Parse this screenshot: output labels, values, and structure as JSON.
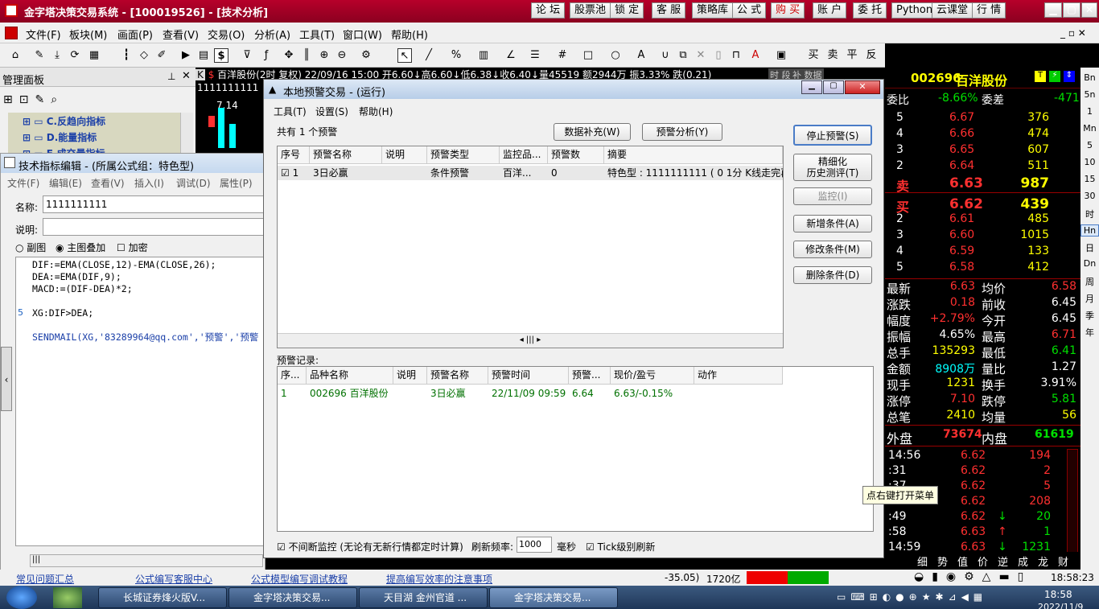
{
  "app": {
    "title": "金字塔决策交易系统 - [100019526] - [技术分析]"
  },
  "top_buttons": [
    "论 坛",
    "股票池",
    "锁 定",
    "客 服",
    "策略库",
    "公 式",
    "购 买",
    "账 户",
    "委 托",
    "Python",
    "云课堂",
    "行 情"
  ],
  "menu": [
    "文件(F)",
    "板块(M)",
    "画面(P)",
    "查看(V)",
    "交易(O)",
    "分析(A)",
    "工具(T)",
    "窗口(W)",
    "帮助(H)"
  ],
  "toolbar_right": [
    "买",
    "卖",
    "平",
    "反"
  ],
  "left_panel": {
    "title": "管理面板",
    "items": [
      "C.反趋向指标",
      "D.能量指标",
      "E.成交量指标"
    ]
  },
  "editor": {
    "title": "技术指标编辑 - (所属公式组：特色型)",
    "menu": [
      "文件(F)",
      "编辑(E)",
      "查看(V)",
      "插入(I)",
      "调试(D)",
      "属性(P)"
    ],
    "name_label": "名称:",
    "name_value": "1111111111",
    "desc_label": "说明:",
    "opt1": "副图",
    "opt2": "主图叠加",
    "opt3": "加密",
    "code": [
      "DIF:=EMA(CLOSE,12)-EMA(CLOSE,26);",
      "DEA:=EMA(DIF,9);",
      "MACD:=(DIF-DEA)*2;",
      "",
      "XG:DIF>DEA;",
      "",
      "SENDMAIL(XG,'83289964@qq.com','预警','预警"
    ],
    "line5": "5"
  },
  "chart": {
    "header": "百洋股份(2时 复权) 22/09/16 15:00 开6.60↓高6.60↓低6.38↓收6.40↓量45519 额2944万 振3.33% 跌(0.21)",
    "label1": "1111111111",
    "label2": "7.14",
    "tag1": "时 段",
    "tag2": "补 数据"
  },
  "dialog": {
    "title": "本地预警交易 - (运行)",
    "menu": [
      "工具(T)",
      "设置(S)",
      "帮助(H)"
    ],
    "count": "共有 1 个预警",
    "btn_data": "数据补充(W)",
    "btn_analysis": "预警分析(Y)",
    "headers": [
      "序号",
      "预警名称",
      "说明",
      "预警类型",
      "监控品...",
      "预警数",
      "摘要"
    ],
    "row": {
      "seq": "1",
      "name": "3日必赢",
      "desc": "",
      "type": "条件预警",
      "target": "百洋...",
      "num": "0",
      "summary": "特色型 : 1111111111 ( 0 1分 K线走完再"
    },
    "btn_stop": "停止预警(S)",
    "btn_refine_1": "精细化",
    "btn_refine_2": "历史测评(T)",
    "btn_monitor": "监控(I)",
    "btn_add": "新增条件(A)",
    "btn_edit": "修改条件(M)",
    "btn_del": "删除条件(D)",
    "records_label": "预警记录:",
    "rec_headers": [
      "序...",
      "品种名称",
      "说明",
      "预警名称",
      "预警时间",
      "预警...",
      "现价/盈亏",
      "动作"
    ],
    "rec_row": {
      "seq": "1",
      "symbol": "002696 百洋股份",
      "desc": "",
      "name": "3日必赢",
      "time": "22/11/09 09:59",
      "price": "6.64",
      "pnl": "6.63/-0.15%",
      "action": ""
    },
    "chk_continuous": "不间断监控 (无论有无新行情都定时计算)",
    "refresh_label": "刷新频率:",
    "refresh_value": "1000",
    "unit": "毫秒",
    "chk_tick": "Tick级别刷新"
  },
  "quote": {
    "code": "002696",
    "name": "百洋股份",
    "weibi_label": "委比",
    "weibi": "-8.66%",
    "weicha_label": "委差",
    "weicha": "-471",
    "sells": [
      {
        "l": "5",
        "p": "6.67",
        "v": "376"
      },
      {
        "l": "4",
        "p": "6.66",
        "v": "474"
      },
      {
        "l": "3",
        "p": "6.65",
        "v": "607"
      },
      {
        "l": "2",
        "p": "6.64",
        "v": "511"
      },
      {
        "l": "卖",
        "p": "6.63",
        "v": "987"
      }
    ],
    "buys": [
      {
        "l": "买",
        "p": "6.62",
        "v": "439"
      },
      {
        "l": "2",
        "p": "6.61",
        "v": "485"
      },
      {
        "l": "3",
        "p": "6.60",
        "v": "1015"
      },
      {
        "l": "4",
        "p": "6.59",
        "v": "133"
      },
      {
        "l": "5",
        "p": "6.58",
        "v": "412"
      }
    ],
    "stats": [
      [
        "最新",
        "6.63",
        "均价",
        "6.58"
      ],
      [
        "涨跌",
        "0.18",
        "前收",
        "6.45"
      ],
      [
        "幅度",
        "+2.79%",
        "今开",
        "6.45"
      ],
      [
        "振幅",
        "4.65%",
        "最高",
        "6.71"
      ],
      [
        "总手",
        "135293",
        "最低",
        "6.41"
      ],
      [
        "金额",
        "8908万",
        "量比",
        "1.27"
      ],
      [
        "现手",
        "1231",
        "换手",
        "3.91%"
      ],
      [
        "涨停",
        "7.10",
        "跌停",
        "5.81"
      ],
      [
        "总笔",
        "2410",
        "均量",
        "56"
      ]
    ],
    "outer_label": "外盘",
    "outer": "73674",
    "inner_label": "内盘",
    "inner": "61619",
    "ticks": [
      {
        "t": "14:56",
        "p": "6.62",
        "a": "",
        "v": "194"
      },
      {
        "t": ":31",
        "p": "6.62",
        "a": "",
        "v": "2"
      },
      {
        "t": ":37",
        "p": "6.62",
        "a": "",
        "v": "5"
      },
      {
        "t": ":43",
        "p": "6.62",
        "a": "",
        "v": "208"
      },
      {
        "t": ":49",
        "p": "6.62",
        "a": "↓",
        "v": "20"
      },
      {
        "t": ":58",
        "p": "6.63",
        "a": "↑",
        "v": "1"
      },
      {
        "t": "14:59",
        "p": "6.63",
        "a": "↓",
        "v": "1231"
      }
    ],
    "tabs": [
      "细",
      "势",
      "值",
      "价",
      "逆",
      "成",
      "龙",
      "财"
    ],
    "tooltip": "点右键打开菜单"
  },
  "sidebar": [
    "Bn",
    "5n",
    "1",
    "Mn",
    "5",
    "10",
    "15",
    "30",
    "时",
    "Hn",
    "日",
    "Dn",
    "周",
    "月",
    "季",
    "年"
  ],
  "links": [
    "常见问题汇总",
    "公式编写客服中心",
    "公式模型编写调试教程",
    "提高编写效率的注意事项"
  ],
  "status": {
    "left": "-35.05)",
    "amount": "1720亿",
    "time": "18:58:23"
  },
  "taskbar": {
    "tasks": [
      "长城证券烽火版V...",
      "金字塔决策交易...",
      "天目湖 金州官道 ...",
      "金字塔决策交易..."
    ],
    "clock": "18:58",
    "date": "2022/11/9"
  }
}
